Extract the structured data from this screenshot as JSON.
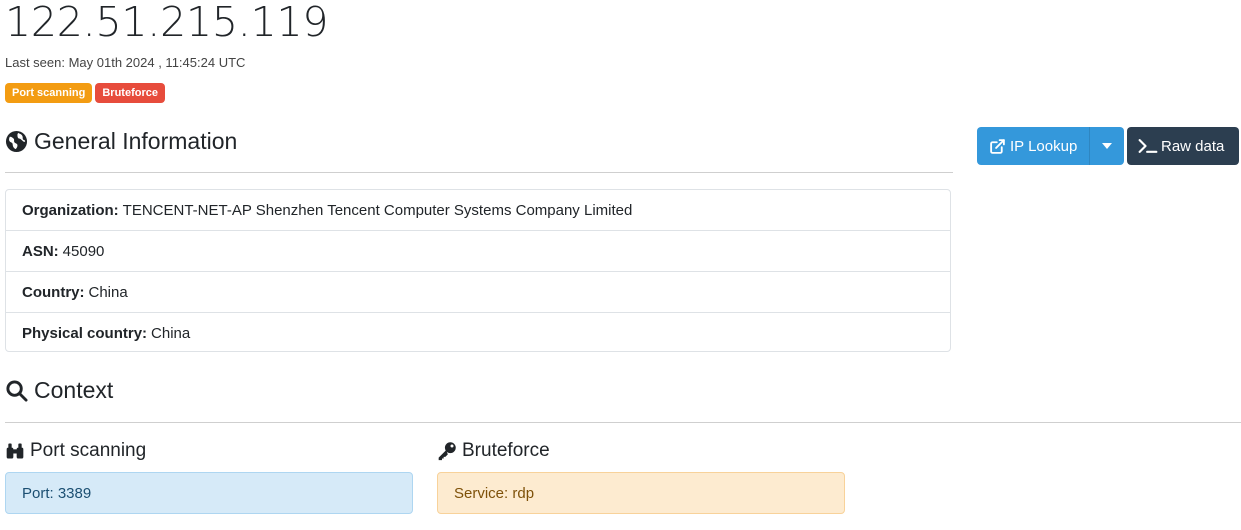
{
  "ip": "122.51.215.119",
  "last_seen": "Last seen: May 01th 2024 , 11:45:24 UTC",
  "tags": [
    {
      "label": "Port scanning",
      "color": "#f39c12"
    },
    {
      "label": "Bruteforce",
      "color": "#e74c3c"
    }
  ],
  "general": {
    "heading": "General Information",
    "icon": "globe-icon",
    "rows": [
      {
        "label": "Organization:",
        "value": "TENCENT-NET-AP Shenzhen Tencent Computer Systems Company Limited"
      },
      {
        "label": "ASN:",
        "value": "45090"
      },
      {
        "label": "Country:",
        "value": "China"
      },
      {
        "label": "Physical country:",
        "value": "China"
      }
    ]
  },
  "actions": {
    "ip_lookup": "IP Lookup",
    "ip_lookup_icon": "external-link-icon",
    "raw_data": "Raw data",
    "raw_data_icon": "terminal-icon"
  },
  "context": {
    "heading": "Context",
    "icon": "search-icon",
    "port_scanning": {
      "heading": "Port scanning",
      "icon": "binoculars-icon",
      "detail": "Port: 3389",
      "color": "#d6eaf8"
    },
    "bruteforce": {
      "heading": "Bruteforce",
      "icon": "key-icon",
      "detail": "Service: rdp",
      "color": "#fdebd0"
    }
  }
}
